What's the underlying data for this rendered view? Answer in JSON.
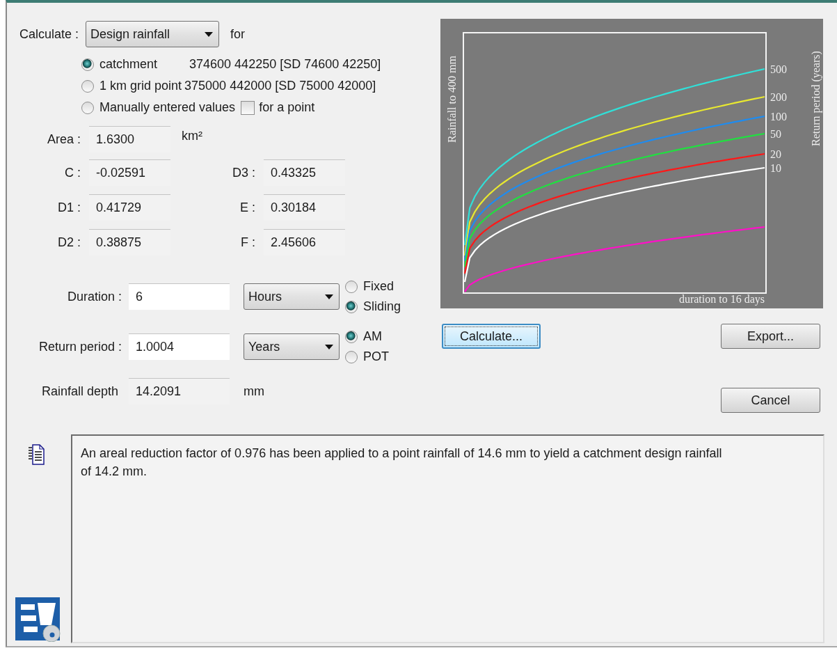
{
  "calculate": {
    "label": "Calculate :",
    "dropdown": "Design rainfall",
    "suffix": "for"
  },
  "location_options": [
    {
      "label": "catchment",
      "selected": true,
      "coords": "374600 442250 [SD 74600 42250]"
    },
    {
      "label": "1 km grid point",
      "selected": false,
      "coords": "375000 442000 [SD 75000 42000]"
    },
    {
      "label": "Manually entered values",
      "selected": false,
      "checkbox": {
        "label": "for a point",
        "checked": false
      }
    }
  ],
  "area": {
    "label": "Area :",
    "value": "1.6300",
    "unit": "km²"
  },
  "parameters": [
    {
      "label": "C :",
      "value": "-0.02591"
    },
    {
      "label": "D3 :",
      "value": "0.43325"
    },
    {
      "label": "D1 :",
      "value": "0.41729"
    },
    {
      "label": "E :",
      "value": "0.30184"
    },
    {
      "label": "D2 :",
      "value": "0.38875"
    },
    {
      "label": "F :",
      "value": "2.45606"
    }
  ],
  "duration": {
    "label": "Duration :",
    "value": "6",
    "unit": "Hours",
    "options": [
      {
        "label": "Fixed",
        "selected": false
      },
      {
        "label": "Sliding",
        "selected": true
      }
    ]
  },
  "return_period": {
    "label": "Return period :",
    "value": "1.0004",
    "unit": "Years",
    "options": [
      {
        "label": "AM",
        "selected": true
      },
      {
        "label": "POT",
        "selected": false
      }
    ]
  },
  "rainfall_depth": {
    "label": "Rainfall depth",
    "value": "14.2091",
    "unit": "mm"
  },
  "chart": {
    "y_title": "Rainfall to 400 mm",
    "x_title": "duration to 16 days",
    "legend_title": "Return period (years)",
    "return_periods": [
      "500",
      "200",
      "100",
      "50",
      "20",
      "10"
    ]
  },
  "buttons": {
    "calculate": {
      "label": "Calculate...",
      "focused": true
    },
    "export": {
      "label": "Export...",
      "focused": false
    },
    "cancel": {
      "label": "Cancel",
      "focused": false
    }
  },
  "message": "An areal reduction factor of 0.976 has been applied to a point rainfall of 14.6 mm to yield a catchment design rainfall of 14.2 mm."
}
